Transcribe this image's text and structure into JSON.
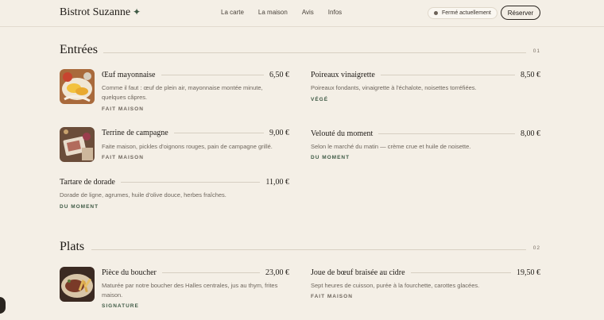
{
  "header": {
    "brand": "Bistrot Suzanne",
    "brand_mark": "✦",
    "nav": [
      "La carte",
      "La maison",
      "Avis",
      "Infos"
    ],
    "status": "Fermé actuellement",
    "reserve_label": "Réserver"
  },
  "sections": [
    {
      "title": "Entrées",
      "number": "01",
      "dishes": [
        {
          "name": "Œuf mayonnaise",
          "price": "6,50 €",
          "desc": "Comme il faut : œuf de plein air, mayonnaise montée minute, quelques câpres.",
          "tag": "FAIT MAISON",
          "image": "egg-mayo-photo"
        },
        {
          "name": "Poireaux vinaigrette",
          "price": "8,50 €",
          "desc": "Poireaux fondants, vinaigrette à l'échalote, noisettes torréfiées.",
          "tag": "VÉGÉ"
        },
        {
          "name": "Terrine de campagne",
          "price": "9,00 €",
          "desc": "Faite maison, pickles d'oignons rouges, pain de campagne grillé.",
          "tag": "FAIT MAISON",
          "image": "terrine-photo"
        },
        {
          "name": "Velouté du moment",
          "price": "8,00 €",
          "desc": "Selon le marché du matin — crème crue et huile de noisette.",
          "tag": "DU MOMENT"
        },
        {
          "name": "Tartare de dorade",
          "price": "11,00 €",
          "desc": "Dorade de ligne, agrumes, huile d'olive douce, herbes fraîches.",
          "tag": "DU MOMENT"
        }
      ]
    },
    {
      "title": "Plats",
      "number": "02",
      "dishes": [
        {
          "name": "Pièce du boucher",
          "price": "23,00 €",
          "desc": "Maturée par notre boucher des Halles centrales, jus au thym, frites maison.",
          "tag": "SIGNATURE",
          "image": "steak-photo"
        },
        {
          "name": "Joue de bœuf braisée au cidre",
          "price": "19,50 €",
          "desc": "Sept heures de cuisson, purée à la fourchette, carottes glacées.",
          "tag": "FAIT MAISON"
        }
      ]
    }
  ],
  "colors": {
    "background": "#f4efe6",
    "accent_green": "#3e5a45",
    "text": "#1f1b17",
    "muted": "#6e665d"
  }
}
